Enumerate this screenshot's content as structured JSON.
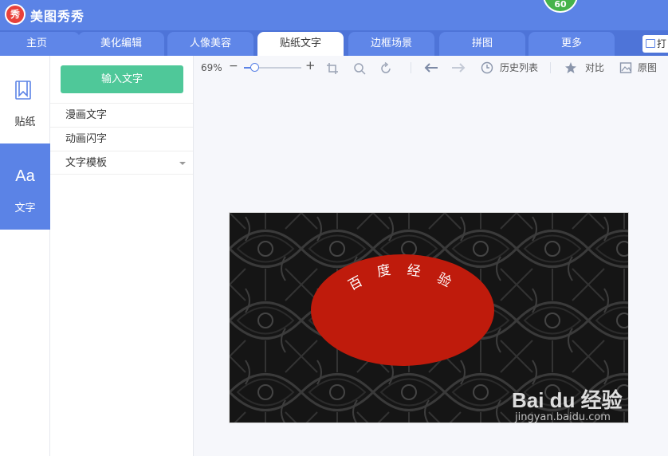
{
  "app": {
    "logo_text": "秀",
    "title": "美图秀秀",
    "badge": "60"
  },
  "tabs": [
    {
      "label": "主页"
    },
    {
      "label": "美化编辑"
    },
    {
      "label": "人像美容"
    },
    {
      "label": "贴纸文字",
      "active": true
    },
    {
      "label": "边框场景"
    },
    {
      "label": "拼图"
    },
    {
      "label": "更多"
    }
  ],
  "open_button": {
    "label": "打"
  },
  "leftnav": {
    "sticker": {
      "label": "贴纸",
      "icon": "bookmark-icon"
    },
    "text": {
      "label": "文字",
      "icon": "font-icon",
      "glyph": "Aa"
    }
  },
  "subpanel": {
    "input_button": "输入文字",
    "items": [
      "漫画文字",
      "动画闪字",
      "文字模板"
    ]
  },
  "toolbar": {
    "zoom": "69%",
    "minus": "−",
    "plus": "+",
    "history": "历史列表",
    "compare": "对比",
    "original": "原图"
  },
  "canvas": {
    "arc_chars": [
      "百",
      "度",
      "经",
      "验"
    ],
    "ellipse_color": "#bf1b0c"
  },
  "watermark": {
    "main": "Bai du 经验",
    "sub": "jingyan.baidu.com"
  },
  "colors": {
    "accent": "#5b83e6",
    "green": "#4fc899",
    "red": "#bf1b0c"
  }
}
